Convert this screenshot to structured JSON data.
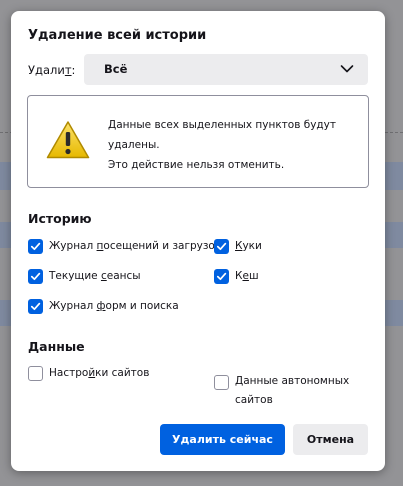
{
  "dialog": {
    "title": "Удаление всей истории",
    "range": {
      "label_before": "Удали",
      "label_access": "т",
      "label_after": ":",
      "selected": "Всё"
    },
    "warning": {
      "line1": "Данные всех выделенных пунктов будут удалены.",
      "line2": "Это действие нельзя отменить."
    },
    "history_section": {
      "heading": "Историю",
      "items": [
        {
          "before": "Журнал ",
          "access": "п",
          "after": "осещений и загрузок",
          "checked": true
        },
        {
          "before": "",
          "access": "К",
          "after": "уки",
          "checked": true
        },
        {
          "before": "Текущие ",
          "access": "с",
          "after": "еансы",
          "checked": true
        },
        {
          "before": "К",
          "access": "е",
          "after": "ш",
          "checked": true
        },
        {
          "before": "Журнал ",
          "access": "ф",
          "after": "орм и поиска",
          "checked": true
        }
      ]
    },
    "data_section": {
      "heading": "Данные",
      "items": [
        {
          "before": "Настро",
          "access": "й",
          "after": "ки сайтов",
          "checked": false
        },
        {
          "before": "Данные автономных сайтов",
          "access": "",
          "after": "",
          "checked": false
        }
      ]
    },
    "buttons": {
      "confirm": "Удалить сейчас",
      "cancel": "Отмена"
    }
  },
  "colors": {
    "accent": "#0061e0",
    "button_secondary": "#ececee",
    "text": "#15141a",
    "warning_icon": "#f0c000"
  },
  "icons": {
    "warning": "warning-triangle-icon",
    "dropdown": "chevron-down-icon",
    "check": "checkmark-icon"
  }
}
